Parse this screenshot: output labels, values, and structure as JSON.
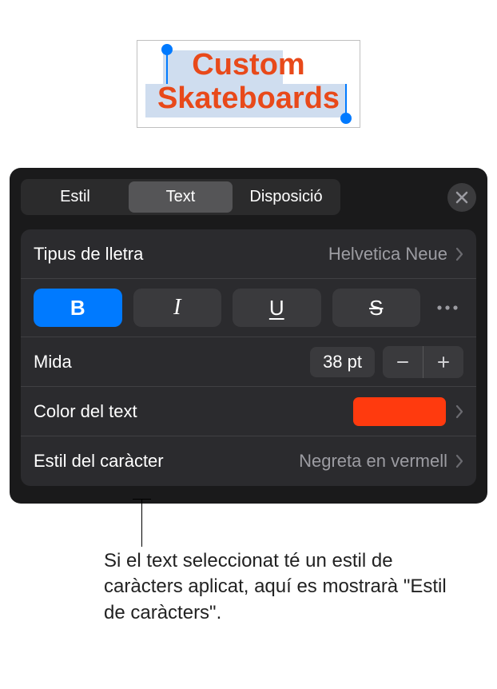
{
  "textbox": {
    "line1": "Custom",
    "line2": "Skateboards"
  },
  "panel": {
    "tabs": {
      "style": "Estil",
      "text": "Text",
      "layout": "Disposició"
    },
    "font_row": {
      "label": "Tipus de lletra",
      "value": "Helvetica Neue"
    },
    "format_glyphs": {
      "bold": "B",
      "italic": "I",
      "underline": "U",
      "strike": "S"
    },
    "size_row": {
      "label": "Mida",
      "value": "38 pt"
    },
    "color_row": {
      "label": "Color del text",
      "swatch_color": "#ff3a0e"
    },
    "charstyle_row": {
      "label": "Estil del caràcter",
      "value": "Negreta en vermell"
    }
  },
  "callout": "Si el text seleccionat té un estil de caràcters aplicat, aquí es mostrarà \"Estil de caràcters\"."
}
